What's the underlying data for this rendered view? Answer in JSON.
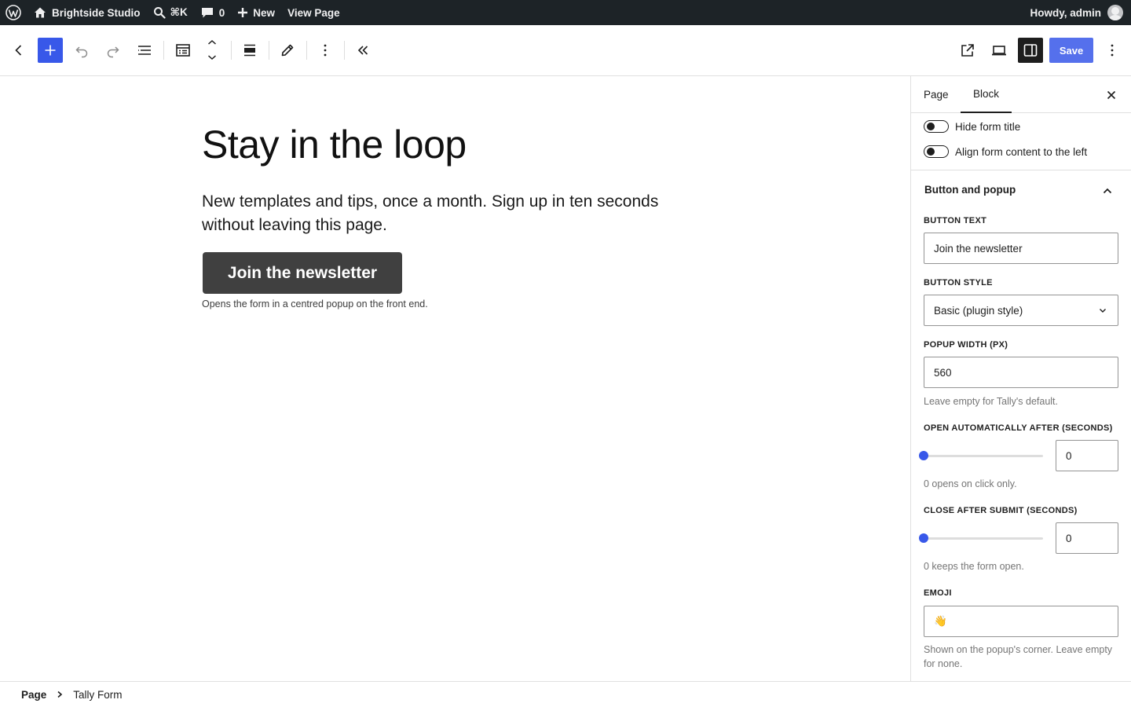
{
  "adminbar": {
    "site_name": "Brightside Studio",
    "search_shortcut": "⌘K",
    "comments_count": "0",
    "new_label": "New",
    "view_page_label": "View Page",
    "howdy": "Howdy, admin"
  },
  "toolbar": {
    "save_label": "Save"
  },
  "canvas": {
    "heading": "Stay in the loop",
    "lead": "New templates and tips, once a month. Sign up in ten seconds without leaving this page.",
    "cta_label": "Join the newsletter",
    "cta_note": "Opens the form in a centred popup on the front end."
  },
  "sidebar": {
    "tabs": [
      {
        "label": "Page",
        "active": false
      },
      {
        "label": "Block",
        "active": true
      }
    ],
    "toggles": [
      {
        "label": "Hide form title",
        "checked": false
      },
      {
        "label": "Align form content to the left",
        "checked": false
      }
    ],
    "panel_title": "Button and popup",
    "button_text": {
      "label": "Button text",
      "value": "Join the newsletter"
    },
    "button_style": {
      "label": "Button style",
      "value": "Basic (plugin style)"
    },
    "popup_width": {
      "label": "Popup width (px)",
      "value": "560",
      "help": "Leave empty for Tally's default."
    },
    "open_after": {
      "label": "Open automatically after (seconds)",
      "value": "0",
      "level": 0,
      "help": "0 opens on click only."
    },
    "close_after": {
      "label": "Close after submit (seconds)",
      "value": "0",
      "level": 0,
      "help": "0 keeps the form open."
    },
    "emoji": {
      "label": "Emoji",
      "value": "👋",
      "help": "Shown on the popup's corner. Leave empty for none."
    }
  },
  "breadcrumb": {
    "items": [
      "Page",
      "Tally Form"
    ]
  },
  "colors": {
    "accent": "#3858e9",
    "adminbar_bg": "#1d2327",
    "cta_bg": "#404040"
  }
}
